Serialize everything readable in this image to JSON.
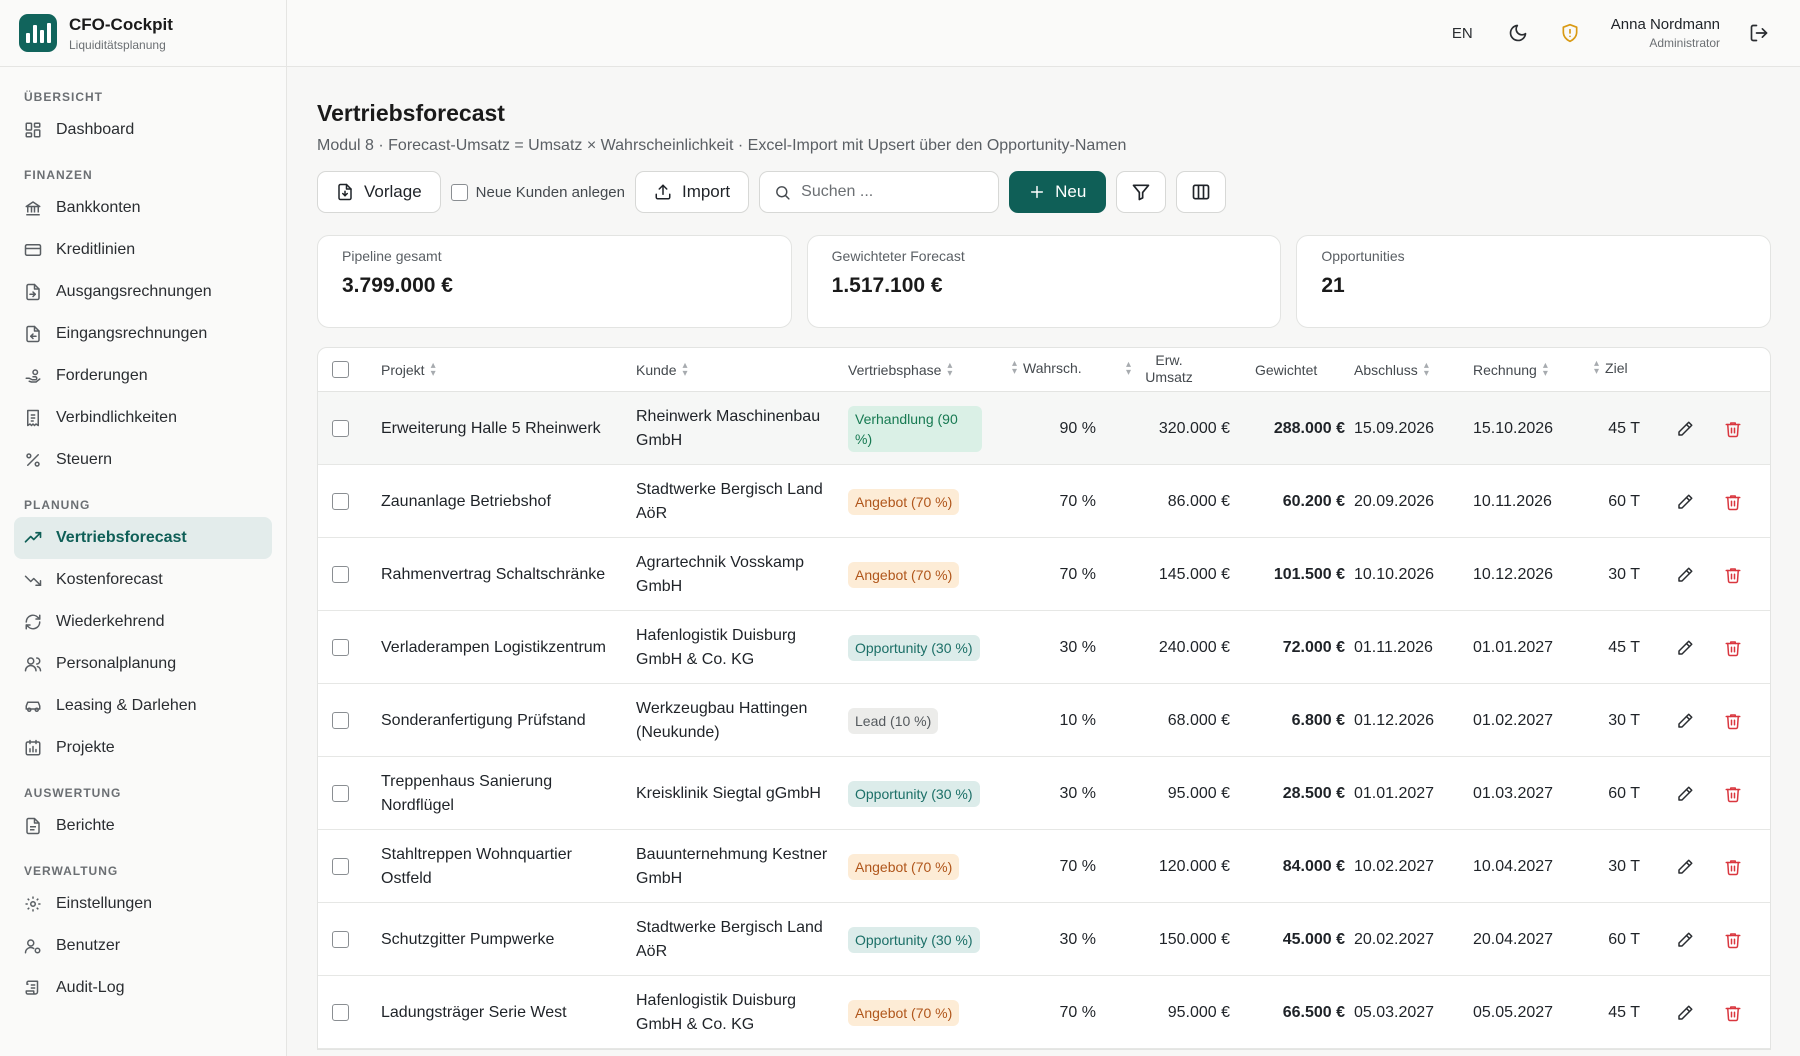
{
  "brand": {
    "title": "CFO-Cockpit",
    "subtitle": "Liquiditätsplanung"
  },
  "sidebar": {
    "sections": [
      {
        "label": "ÜBERSICHT",
        "items": [
          {
            "label": "Dashboard",
            "icon": "dashboard-icon"
          }
        ]
      },
      {
        "label": "FINANZEN",
        "items": [
          {
            "label": "Bankkonten",
            "icon": "bank-icon"
          },
          {
            "label": "Kreditlinien",
            "icon": "credit-card-icon"
          },
          {
            "label": "Ausgangsrechnungen",
            "icon": "invoice-out-icon"
          },
          {
            "label": "Eingangsrechnungen",
            "icon": "invoice-in-icon"
          },
          {
            "label": "Forderungen",
            "icon": "hand-coins-icon"
          },
          {
            "label": "Verbindlichkeiten",
            "icon": "receipt-icon"
          },
          {
            "label": "Steuern",
            "icon": "percent-icon"
          }
        ]
      },
      {
        "label": "PLANUNG",
        "items": [
          {
            "label": "Vertriebsforecast",
            "icon": "trending-up-icon",
            "active": true
          },
          {
            "label": "Kostenforecast",
            "icon": "trending-down-icon"
          },
          {
            "label": "Wiederkehrend",
            "icon": "refresh-icon"
          },
          {
            "label": "Personalplanung",
            "icon": "users-icon"
          },
          {
            "label": "Leasing & Darlehen",
            "icon": "car-icon"
          },
          {
            "label": "Projekte",
            "icon": "calendar-chart-icon"
          }
        ]
      },
      {
        "label": "AUSWERTUNG",
        "items": [
          {
            "label": "Berichte",
            "icon": "document-icon"
          }
        ]
      },
      {
        "label": "VERWALTUNG",
        "items": [
          {
            "label": "Einstellungen",
            "icon": "gear-icon"
          },
          {
            "label": "Benutzer",
            "icon": "user-gear-icon"
          },
          {
            "label": "Audit-Log",
            "icon": "scroll-icon"
          }
        ]
      }
    ]
  },
  "topbar": {
    "lang": "EN",
    "user_name": "Anna Nordmann",
    "user_role": "Administrator"
  },
  "page": {
    "title": "Vertriebsforecast",
    "subtitle": "Modul 8 · Forecast-Umsatz = Umsatz × Wahrscheinlichkeit · Excel-Import mit Upsert über den Opportunity-Namen"
  },
  "toolbar": {
    "template_label": "Vorlage",
    "new_customers_label": "Neue Kunden anlegen",
    "import_label": "Import",
    "search_placeholder": "Suchen ...",
    "new_label": "Neu"
  },
  "cards": [
    {
      "label": "Pipeline gesamt",
      "value": "3.799.000 €"
    },
    {
      "label": "Gewichteter Forecast",
      "value": "1.517.100 €"
    },
    {
      "label": "Opportunities",
      "value": "21"
    }
  ],
  "table": {
    "headers": {
      "projekt": "Projekt",
      "kunde": "Kunde",
      "phase": "Vertriebsphase",
      "wahrsch": "Wahrsch.",
      "umsatz": "Erw. Umsatz",
      "gewichtet": "Gewichtet",
      "abschluss": "Abschluss",
      "rechnung": "Rechnung",
      "ziel": "Ziel"
    },
    "rows": [
      {
        "projekt": "Erweiterung Halle 5 Rheinwerk",
        "kunde": "Rheinwerk Maschinenbau GmbH",
        "phase": "Verhandlung (90 %)",
        "phase_type": "verh",
        "wahrsch": "90 %",
        "umsatz": "320.000 €",
        "gewichtet": "288.000 €",
        "abschluss": "15.09.2026",
        "rechnung": "15.10.2026",
        "ziel": "45 T"
      },
      {
        "projekt": "Zaunanlage Betriebshof",
        "kunde": "Stadtwerke Bergisch Land AöR",
        "phase": "Angebot (70 %)",
        "phase_type": "ang",
        "wahrsch": "70 %",
        "umsatz": "86.000 €",
        "gewichtet": "60.200 €",
        "abschluss": "20.09.2026",
        "rechnung": "10.11.2026",
        "ziel": "60 T"
      },
      {
        "projekt": "Rahmenvertrag Schaltschränke",
        "kunde": "Agrartechnik Vosskamp GmbH",
        "phase": "Angebot (70 %)",
        "phase_type": "ang",
        "wahrsch": "70 %",
        "umsatz": "145.000 €",
        "gewichtet": "101.500 €",
        "abschluss": "10.10.2026",
        "rechnung": "10.12.2026",
        "ziel": "30 T"
      },
      {
        "projekt": "Verladerampen Logistikzentrum",
        "kunde": "Hafenlogistik Duisburg GmbH & Co. KG",
        "phase": "Opportunity (30 %)",
        "phase_type": "opp",
        "wahrsch": "30 %",
        "umsatz": "240.000 €",
        "gewichtet": "72.000 €",
        "abschluss": "01.11.2026",
        "rechnung": "01.01.2027",
        "ziel": "45 T"
      },
      {
        "projekt": "Sonderanfertigung Prüfstand",
        "kunde": "Werkzeugbau Hattingen (Neukunde)",
        "phase": "Lead (10 %)",
        "phase_type": "lead",
        "wahrsch": "10 %",
        "umsatz": "68.000 €",
        "gewichtet": "6.800 €",
        "abschluss": "01.12.2026",
        "rechnung": "01.02.2027",
        "ziel": "30 T"
      },
      {
        "projekt": "Treppenhaus Sanierung Nordflügel",
        "kunde": "Kreisklinik Siegtal gGmbH",
        "phase": "Opportunity (30 %)",
        "phase_type": "opp",
        "wahrsch": "30 %",
        "umsatz": "95.000 €",
        "gewichtet": "28.500 €",
        "abschluss": "01.01.2027",
        "rechnung": "01.03.2027",
        "ziel": "60 T"
      },
      {
        "projekt": "Stahltreppen Wohnquartier Ostfeld",
        "kunde": "Bauunternehmung Kestner GmbH",
        "phase": "Angebot (70 %)",
        "phase_type": "ang",
        "wahrsch": "70 %",
        "umsatz": "120.000 €",
        "gewichtet": "84.000 €",
        "abschluss": "10.02.2027",
        "rechnung": "10.04.2027",
        "ziel": "30 T"
      },
      {
        "projekt": "Schutzgitter Pumpwerke",
        "kunde": "Stadtwerke Bergisch Land AöR",
        "phase": "Opportunity (30 %)",
        "phase_type": "opp",
        "wahrsch": "30 %",
        "umsatz": "150.000 €",
        "gewichtet": "45.000 €",
        "abschluss": "20.02.2027",
        "rechnung": "20.04.2027",
        "ziel": "60 T"
      },
      {
        "projekt": "Ladungsträger Serie West",
        "kunde": "Hafenlogistik Duisburg GmbH & Co. KG",
        "phase": "Angebot (70 %)",
        "phase_type": "ang",
        "wahrsch": "70 %",
        "umsatz": "95.000 €",
        "gewichtet": "66.500 €",
        "abschluss": "05.03.2027",
        "rechnung": "05.05.2027",
        "ziel": "45 T"
      }
    ]
  },
  "colors": {
    "primary": "#0f5f57",
    "delete": "#d9363e",
    "warning": "#d99a14"
  }
}
